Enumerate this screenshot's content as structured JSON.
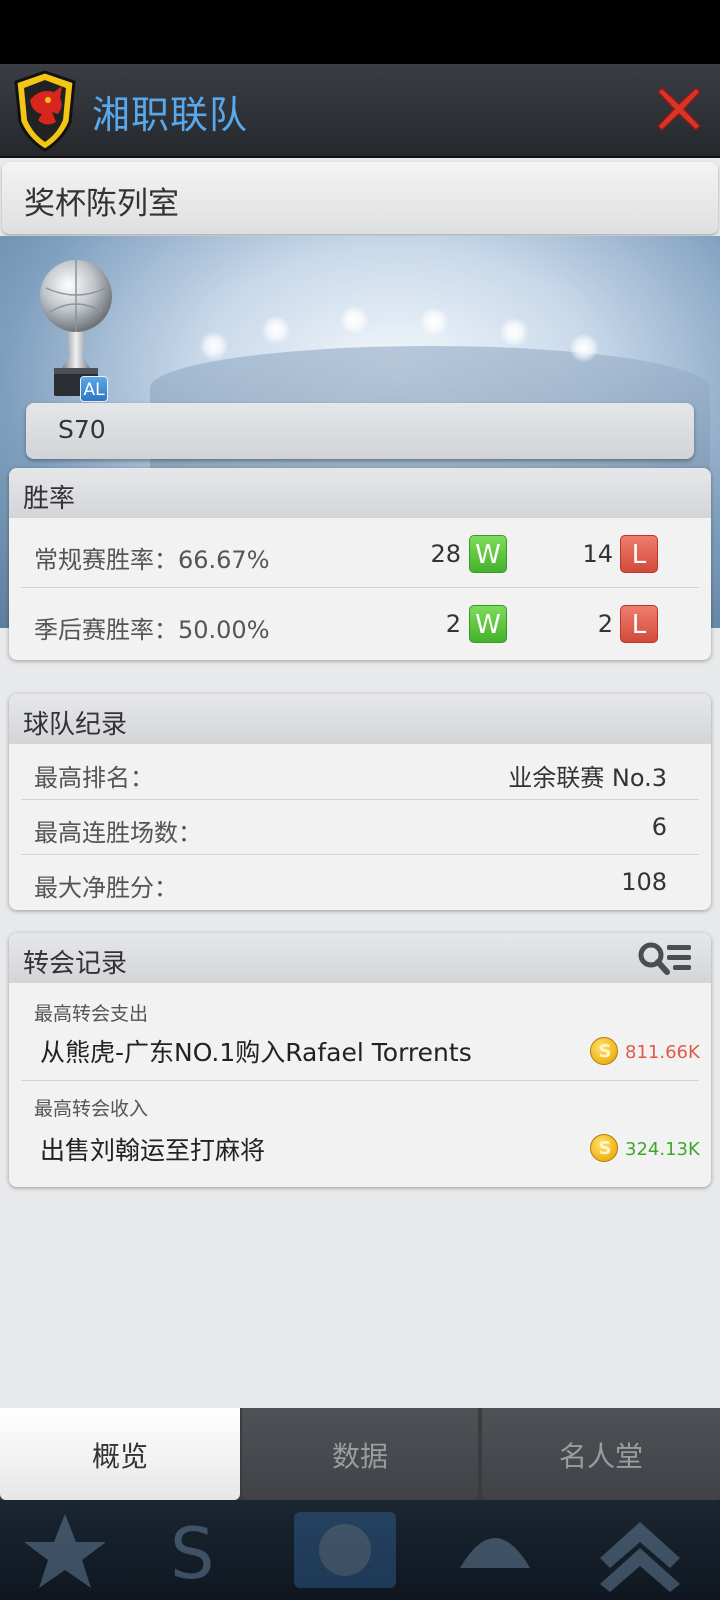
{
  "header": {
    "team_name": "湘职联队"
  },
  "section_title": "奖杯陈列室",
  "trophy": {
    "badge": "AL",
    "season": "S70"
  },
  "win_rate": {
    "title": "胜率",
    "rows": [
      {
        "label": "常规赛胜率：66.67%",
        "wins": "28",
        "w": "W",
        "losses": "14",
        "l": "L"
      },
      {
        "label": "季后赛胜率：50.00%",
        "wins": "2",
        "w": "W",
        "losses": "2",
        "l": "L"
      }
    ]
  },
  "records": {
    "title": "球队纪录",
    "rows": [
      {
        "label": "最高排名：",
        "value": "业余联赛 No.3"
      },
      {
        "label": "最高连胜场数：",
        "value": "6"
      },
      {
        "label": "最大净胜分：",
        "value": "108"
      }
    ]
  },
  "transfers": {
    "title": "转会记录",
    "items": [
      {
        "caption": "最高转会支出",
        "text": "从熊虎-广东NO.1购入Rafael Torrents",
        "amount": "811.66K",
        "amount_color": "#e05a4a"
      },
      {
        "caption": "最高转会收入",
        "text": "出售刘翰运至打麻将",
        "amount": "324.13K",
        "amount_color": "#3fa82a"
      }
    ]
  },
  "tabs": [
    {
      "label": "概览",
      "active": true
    },
    {
      "label": "数据",
      "active": false
    },
    {
      "label": "名人堂",
      "active": false
    }
  ],
  "colors": {
    "accent": "#58a8ec",
    "win": "#43b22c",
    "loss": "#d24b3c"
  },
  "icons": [
    "team-logo-icon",
    "close-icon",
    "trophy-icon",
    "search-list-icon",
    "coin-icon"
  ]
}
